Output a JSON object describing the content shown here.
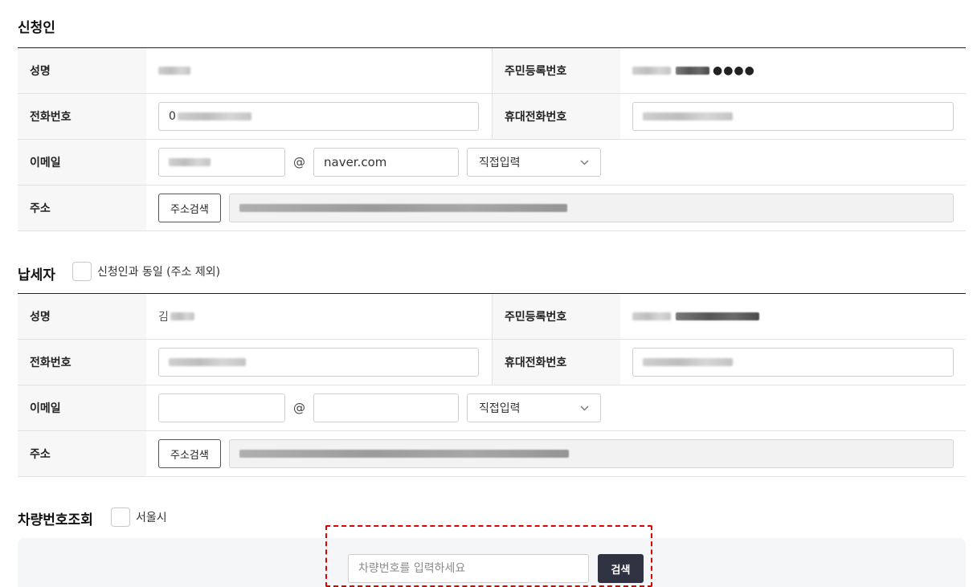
{
  "applicant": {
    "title": "신청인",
    "labels": {
      "name": "성명",
      "rrn": "주민등록번호",
      "phone": "전화번호",
      "mobile": "휴대전화번호",
      "email": "이메일",
      "address": "주소"
    },
    "phone_prefix": "0",
    "rrn_mask": "●●●●",
    "email_domain": "naver.com",
    "domain_select": "직접입력",
    "address_button": "주소검색"
  },
  "taxpayer": {
    "title": "납세자",
    "same_as_applicant_label": "신청인과 동일 (주소 제외)",
    "labels": {
      "name": "성명",
      "rrn": "주민등록번호",
      "phone": "전화번호",
      "mobile": "휴대전화번호",
      "email": "이메일",
      "address": "주소"
    },
    "name_prefix": "김",
    "email_domain": "",
    "domain_select": "직접입력",
    "address_button": "주소검색"
  },
  "vehicle_search": {
    "title": "차량번호조회",
    "seoul_label": "서울시",
    "input_placeholder": "차량번호를 입력하세요",
    "search_button": "검색"
  },
  "icons": {
    "select_arrow": "chevron-down-icon"
  },
  "colors": {
    "search_button_bg": "#2f3241",
    "highlight_border": "#e00000",
    "header_bg": "#f7f7f7"
  }
}
